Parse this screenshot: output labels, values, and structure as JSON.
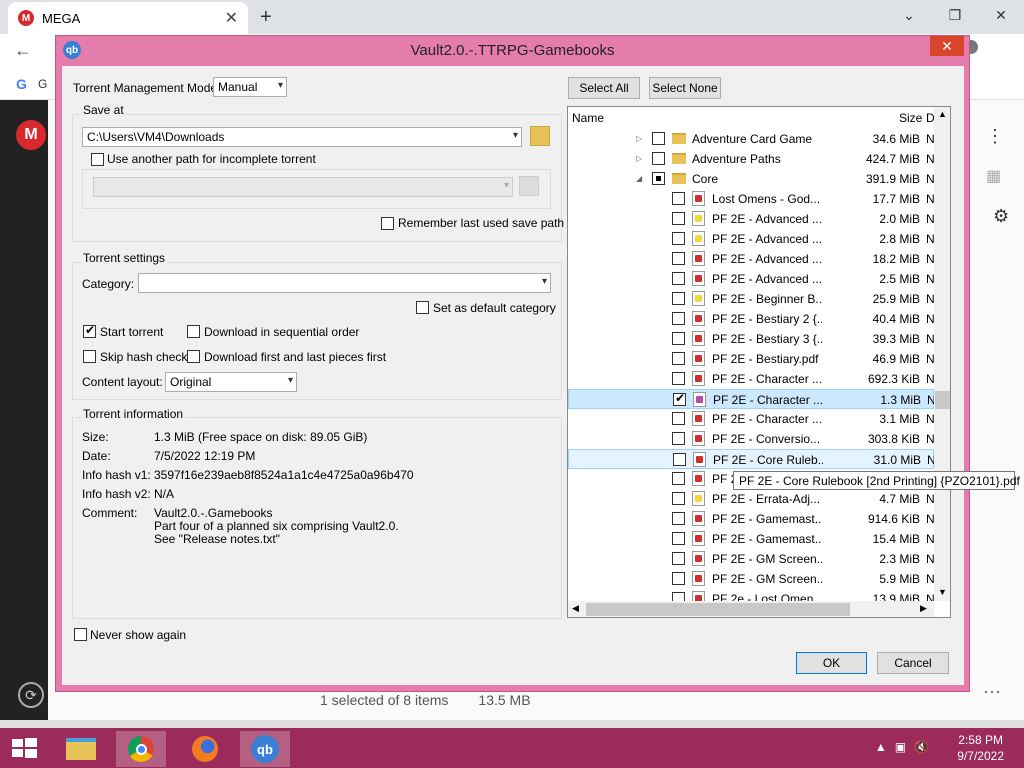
{
  "browser": {
    "tab_title": "MEGA",
    "tab_close": "✕",
    "new_tab": "+",
    "mega_logo": "M",
    "bookmark_g": "G",
    "status_selected": "1 selected of 8 items",
    "status_size": "13.5 MB"
  },
  "window_controls": {
    "dropdown": "⌄",
    "restore": "❐",
    "close": "✕"
  },
  "dialog": {
    "title": "Vault2.0.-.TTRPG-Gamebooks",
    "app_icon": "qb",
    "close": "✕",
    "torrent_mode_label": "Torrent Management Mode:",
    "torrent_mode_value": "Manual",
    "save_at_label": "Save at",
    "save_path": "C:\\Users\\VM4\\Downloads",
    "use_another_path": "Use another path for incomplete torrent",
    "remember_path": "Remember last used save path",
    "torrent_settings_label": "Torrent settings",
    "category_label": "Category:",
    "category_value": "",
    "default_category": "Set as default category",
    "start_torrent": "Start torrent",
    "sequential": "Download in sequential order",
    "skip_hash": "Skip hash check",
    "first_last": "Download first and last pieces first",
    "content_layout_label": "Content layout:",
    "content_layout_value": "Original",
    "info_label": "Torrent information",
    "size_label": "Size:",
    "size_value": "1.3 MiB (Free space on disk: 89.05 GiB)",
    "date_label": "Date:",
    "date_value": "7/5/2022 12:19 PM",
    "hash1_label": "Info hash v1:",
    "hash1_value": "3597f16e239aeb8f8524a1a1c4e4725a0a96b470",
    "hash2_label": "Info hash v2:",
    "hash2_value": "N/A",
    "comment_label": "Comment:",
    "comment_1": "Vault2.0.-.Gamebooks",
    "comment_2": "Part four of a planned six comprising Vault2.0.",
    "comment_3": "See \"Release notes.txt\"",
    "never_show": "Never show again",
    "select_all": "Select All",
    "select_none": "Select None",
    "col_name": "Name",
    "col_size": "Size",
    "col_d": "D",
    "ok": "OK",
    "cancel": "Cancel",
    "tooltip": "PF 2E - Core Rulebook [2nd Printing] {PZO2101}.pdf"
  },
  "files": [
    {
      "name": "Adventure Card Game",
      "size": "34.6 MiB",
      "kind": "folder",
      "expander": "▷",
      "check": "off"
    },
    {
      "name": "Adventure Paths",
      "size": "424.7 MiB",
      "kind": "folder",
      "expander": "▷",
      "check": "off"
    },
    {
      "name": "Core",
      "size": "391.9 MiB",
      "kind": "folder",
      "expander": "◢",
      "check": "partial"
    },
    {
      "name": "Lost Omens - God...",
      "size": "17.7 MiB",
      "kind": "pdf",
      "check": "off"
    },
    {
      "name": "PF 2E - Advanced ...",
      "size": "2.0 MiB",
      "kind": "pdfy",
      "check": "off"
    },
    {
      "name": "PF 2E - Advanced ...",
      "size": "2.8 MiB",
      "kind": "pdfy",
      "check": "off"
    },
    {
      "name": "PF 2E - Advanced ...",
      "size": "18.2 MiB",
      "kind": "pdf",
      "check": "off"
    },
    {
      "name": "PF 2E - Advanced ...",
      "size": "2.5 MiB",
      "kind": "pdf",
      "check": "off"
    },
    {
      "name": "PF 2E - Beginner B...",
      "size": "25.9 MiB",
      "kind": "pdfy",
      "check": "off"
    },
    {
      "name": "PF 2E - Bestiary 2 {...",
      "size": "40.4 MiB",
      "kind": "pdf",
      "check": "off"
    },
    {
      "name": "PF 2E - Bestiary 3 {...",
      "size": "39.3 MiB",
      "kind": "pdf",
      "check": "off"
    },
    {
      "name": "PF 2E - Bestiary.pdf",
      "size": "46.9 MiB",
      "kind": "pdf",
      "check": "off"
    },
    {
      "name": "PF 2E - Character ...",
      "size": "692.3 KiB",
      "kind": "pdf",
      "check": "off"
    },
    {
      "name": "PF 2E - Character ...",
      "size": "1.3 MiB",
      "kind": "pdfp",
      "check": "on"
    },
    {
      "name": "PF 2E - Character ...",
      "size": "3.1 MiB",
      "kind": "pdf",
      "check": "off"
    },
    {
      "name": "PF 2E - Conversio...",
      "size": "303.8 KiB",
      "kind": "pdf",
      "check": "off"
    },
    {
      "name": "PF 2E - Core Ruleb...",
      "size": "31.0 MiB",
      "kind": "pdf",
      "check": "off"
    },
    {
      "name": "PF 2",
      "size": "",
      "kind": "pdf",
      "check": "off"
    },
    {
      "name": "PF 2E - Errata-Adj...",
      "size": "4.7 MiB",
      "kind": "pdfy",
      "check": "off"
    },
    {
      "name": "PF 2E - Gamemast...",
      "size": "914.6 KiB",
      "kind": "pdf",
      "check": "off"
    },
    {
      "name": "PF 2E - Gamemast...",
      "size": "15.4 MiB",
      "kind": "pdf",
      "check": "off"
    },
    {
      "name": "PF 2E - GM Screen...",
      "size": "2.3 MiB",
      "kind": "pdf",
      "check": "off"
    },
    {
      "name": "PF 2E - GM Screen...",
      "size": "5.9 MiB",
      "kind": "pdf",
      "check": "off"
    },
    {
      "name": "PF 2e - Lost Omen...",
      "size": "13.9 MiB",
      "kind": "pdf",
      "check": "off"
    }
  ],
  "col_n": "N",
  "taskbar": {
    "time": "2:58 PM",
    "date": "9/7/2022",
    "qb": "qb"
  }
}
